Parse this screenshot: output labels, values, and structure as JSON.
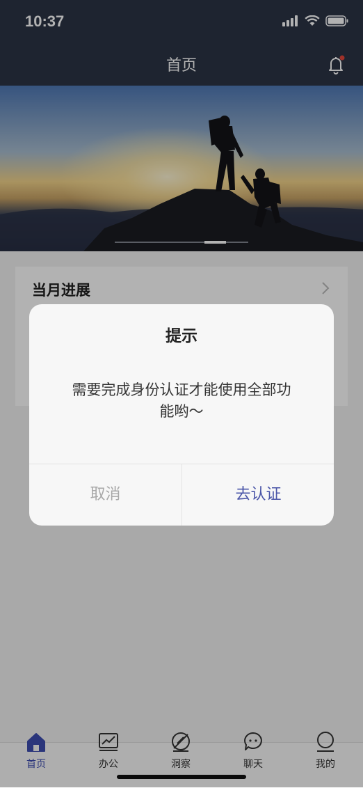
{
  "status_bar": {
    "time": "10:37"
  },
  "nav": {
    "title": "首页"
  },
  "banner": {
    "page_count": 2,
    "active_page": 2
  },
  "progress_card": {
    "title": "当月进展"
  },
  "dialog": {
    "title": "提示",
    "message": "需要完成身份认证才能使用全部功能哟～",
    "cancel_label": "取消",
    "confirm_label": "去认证"
  },
  "tabs": [
    {
      "label": "首页",
      "icon": "home-icon",
      "active": true
    },
    {
      "label": "办公",
      "icon": "chart-icon",
      "active": false
    },
    {
      "label": "洞察",
      "icon": "compass-icon",
      "active": false
    },
    {
      "label": "聊天",
      "icon": "chat-icon",
      "active": false
    },
    {
      "label": "我的",
      "icon": "profile-icon",
      "active": false
    }
  ],
  "colors": {
    "header_bg": "#2c3446",
    "accent": "#3d4cb0",
    "notification_dot": "#e5473c",
    "confirm_text": "#4a55a8",
    "cancel_text": "#a8a8a8"
  }
}
